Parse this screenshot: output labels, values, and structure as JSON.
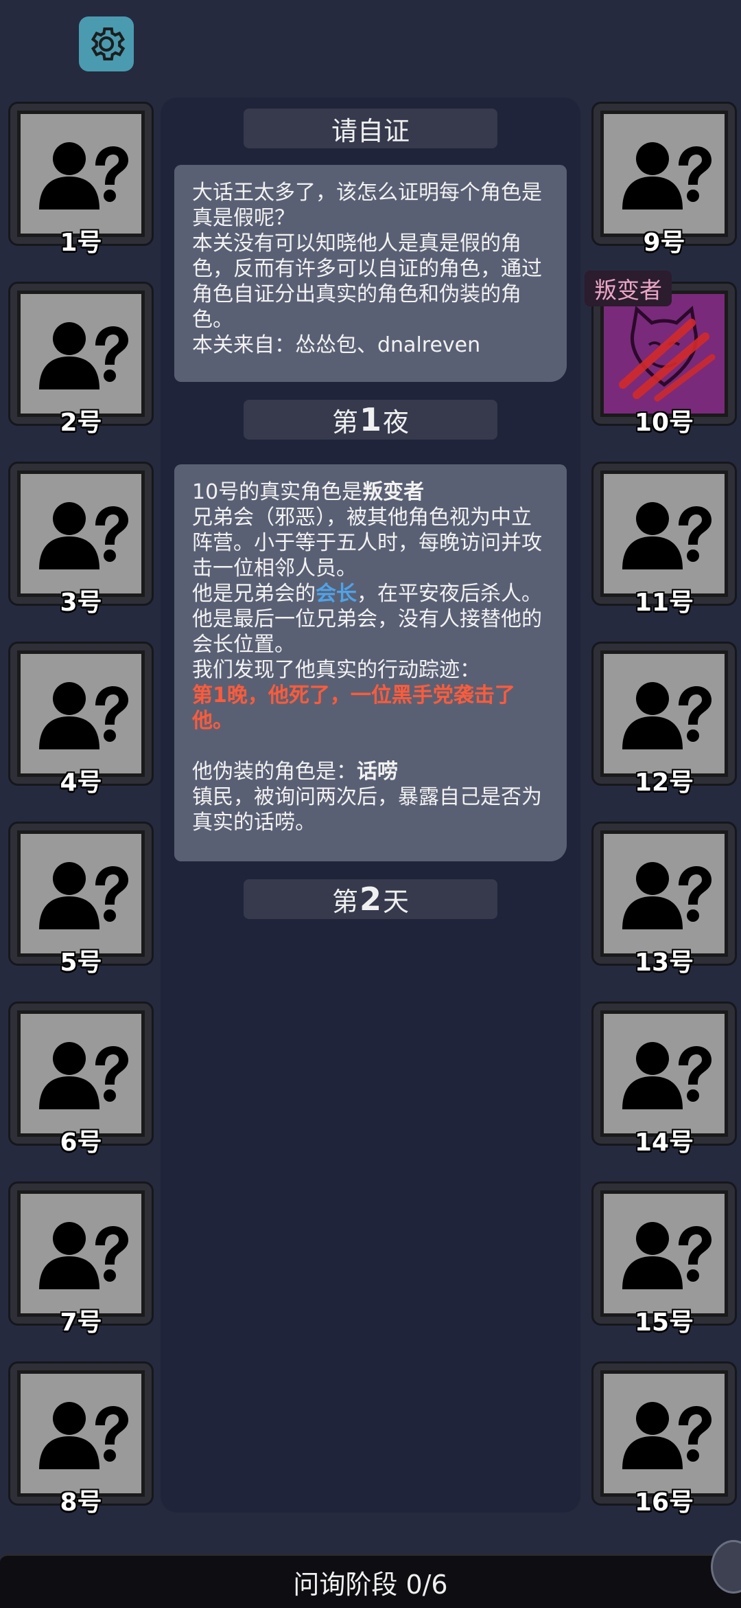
{
  "settings": {
    "icon": "gear-icon"
  },
  "left_players": [
    "1号",
    "2号",
    "3号",
    "4号",
    "5号",
    "6号",
    "7号",
    "8号"
  ],
  "right_players": [
    {
      "label": "9号"
    },
    {
      "label": "10号",
      "role_tag": "叛变者",
      "revealed": true
    },
    {
      "label": "11号"
    },
    {
      "label": "12号"
    },
    {
      "label": "13号"
    },
    {
      "label": "14号"
    },
    {
      "label": "15号"
    },
    {
      "label": "16号"
    }
  ],
  "log": {
    "title": "请自证",
    "intro": [
      "大话王太多了，该怎么证明每个角色是真是假呢？",
      "本关没有可以知晓他人是真是假的角色，反而有许多可以自证的角色，通过角色自证分出真实的角色和伪装的角色。",
      "本关来自：怂怂包、dnalreven"
    ],
    "night1": {
      "prefix": "第",
      "num": "1",
      "suffix": "夜"
    },
    "reveal": {
      "line1_prefix": "10号的真实角色是",
      "line1_role": "叛变者",
      "desc": "兄弟会（邪恶），被其他角色视为中立阵营。小于等于五人时，每晚访问并攻击一位相邻人员。",
      "leader_prefix": "他是兄弟会的",
      "leader_role": "会长",
      "leader_suffix": "，在平安夜后杀人。他是最后一位兄弟会，没有人接替他的会长位置。",
      "track_intro": "我们发现了他真实的行动踪迹：",
      "track": "第1晚，他死了，一位黑手党袭击了他。",
      "fake_prefix": "他伪装的角色是：",
      "fake_role": "话唠",
      "fake_desc": "镇民，被询问两次后，暴露自己是否为真实的话唠。"
    },
    "day2": {
      "prefix": "第",
      "num": "2",
      "suffix": "天"
    }
  },
  "phase": {
    "label": "问询阶段 0/6"
  }
}
